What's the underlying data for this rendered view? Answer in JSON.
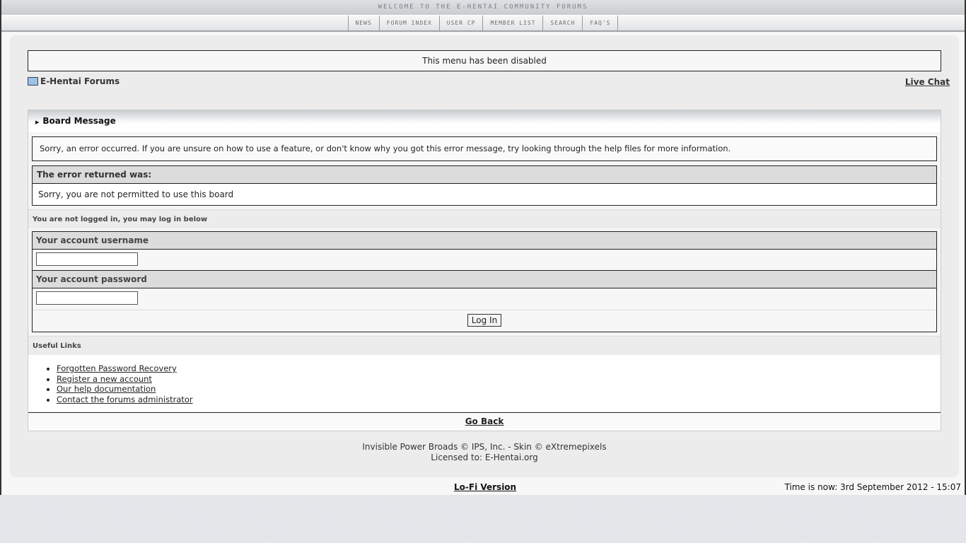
{
  "header": {
    "banner": "Welcome to the E-Hentai Community Forums",
    "nav": [
      "News",
      "Forum Index",
      "User CP",
      "Member List",
      "Search",
      "FAQ's"
    ]
  },
  "notice": "This menu has been disabled",
  "breadcrumb": "E-Hentai Forums",
  "live_chat": "Live Chat",
  "board": {
    "title": "Board Message",
    "message": "Sorry, an error occurred. If you are unsure on how to use a feature, or don't know why you got this error message, try looking through the help files for more information.",
    "error_heading": "The error returned was:",
    "error_text": "Sorry, you are not permitted to use this board"
  },
  "login": {
    "intro": "You are not logged in, you may log in below",
    "username_label": "Your account username",
    "username_value": "",
    "password_label": "Your account password",
    "password_value": "",
    "submit": "Log In"
  },
  "useful": {
    "title": "Useful Links",
    "links": [
      "Forgotten Password Recovery",
      "Register a new account",
      "Our help documentation",
      "Contact the forums administrator"
    ]
  },
  "go_back": "Go Back",
  "copyright": {
    "line1": "Invisible Power Broads © IPS, Inc. - Skin © eXtremepixels",
    "line2": "Licensed to: E-Hentai.org"
  },
  "footer": {
    "lofi": "Lo-Fi Version",
    "time": "Time is now: 3rd September 2012 - 15:07"
  }
}
